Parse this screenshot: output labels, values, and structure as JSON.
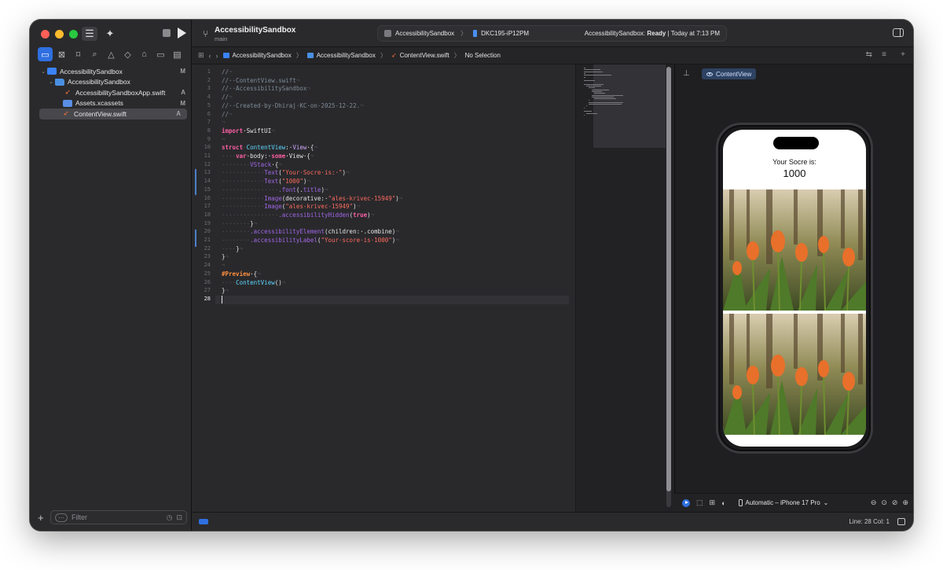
{
  "window": {
    "project_title": "AccessibilitySandbox",
    "branch": "main"
  },
  "activity": {
    "scheme": "AccessibilitySandbox",
    "separator": "〉",
    "device": "DKC195-iP12PM",
    "status_prefix": "AccessibilitySandbox: ",
    "status_state": "Ready",
    "status_suffix": " | Today at 7:13 PM"
  },
  "sidebar": {
    "nav_icons": [
      "folder-icon",
      "x-square-icon",
      "bookmark-icon",
      "search-icon",
      "warning-icon",
      "diamond-icon",
      "tag-icon",
      "breakpoint-icon",
      "report-icon"
    ],
    "tree": [
      {
        "label": "AccessibilitySandbox",
        "badge": "M",
        "kind": "proj",
        "indent": 0,
        "chev": "⌄"
      },
      {
        "label": "AccessibilitySandbox",
        "badge": "",
        "kind": "folder",
        "indent": 1,
        "chev": "⌄"
      },
      {
        "label": "AccessibilitySandboxApp.swift",
        "badge": "A",
        "kind": "swift",
        "indent": 2,
        "chev": ""
      },
      {
        "label": "Assets.xcassets",
        "badge": "M",
        "kind": "assets",
        "indent": 2,
        "chev": ""
      },
      {
        "label": "ContentView.swift",
        "badge": "A",
        "kind": "swift",
        "indent": 2,
        "chev": "",
        "selected": true
      }
    ],
    "filter_placeholder": "Filter"
  },
  "jumpbar": {
    "crumbs": [
      "AccessibilitySandbox",
      "AccessibilitySandbox",
      "ContentView.swift",
      "No Selection"
    ],
    "separator": "〉"
  },
  "editor": {
    "current_line": 28,
    "lines": [
      [
        {
          "t": "//",
          "c": "cm"
        },
        {
          "t": "¬",
          "c": "inv"
        }
      ],
      [
        {
          "t": "//·",
          "c": "cm"
        },
        {
          "t": "·ContentView.swift",
          "c": "cm"
        },
        {
          "t": "¬",
          "c": "inv"
        }
      ],
      [
        {
          "t": "//·",
          "c": "cm"
        },
        {
          "t": "·AccessibilitySandbox",
          "c": "cm"
        },
        {
          "t": "¬",
          "c": "inv"
        }
      ],
      [
        {
          "t": "//",
          "c": "cm"
        },
        {
          "t": "¬",
          "c": "inv"
        }
      ],
      [
        {
          "t": "//·",
          "c": "cm"
        },
        {
          "t": "·Created·by·Dhiraj·KC·on·2025-12-22.",
          "c": "cm"
        },
        {
          "t": "¬",
          "c": "inv"
        }
      ],
      [
        {
          "t": "//",
          "c": "cm"
        },
        {
          "t": "¬",
          "c": "inv"
        }
      ],
      [
        {
          "t": "¬",
          "c": "inv"
        }
      ],
      [
        {
          "t": "import",
          "c": "kw"
        },
        {
          "t": "·SwiftUI",
          "c": "pl"
        },
        {
          "t": "¬",
          "c": "inv"
        }
      ],
      [
        {
          "t": "¬",
          "c": "inv"
        }
      ],
      [
        {
          "t": "struct",
          "c": "kw"
        },
        {
          "t": "·",
          "c": "inv"
        },
        {
          "t": "ContentView",
          "c": "ty"
        },
        {
          "t": ":·",
          "c": "pl"
        },
        {
          "t": "View",
          "c": "ty2"
        },
        {
          "t": "·{",
          "c": "pl"
        },
        {
          "t": "¬",
          "c": "inv"
        }
      ],
      [
        {
          "t": "····",
          "c": "inv"
        },
        {
          "t": "var",
          "c": "kw"
        },
        {
          "t": "·body:·",
          "c": "pl"
        },
        {
          "t": "some",
          "c": "kw"
        },
        {
          "t": "·View·{",
          "c": "pl"
        },
        {
          "t": "¬",
          "c": "inv"
        }
      ],
      [
        {
          "t": "········",
          "c": "inv"
        },
        {
          "t": "VStack",
          "c": "fn"
        },
        {
          "t": "·{",
          "c": "pl"
        },
        {
          "t": "¬",
          "c": "inv"
        }
      ],
      [
        {
          "t": "············",
          "c": "inv"
        },
        {
          "t": "Text",
          "c": "fn"
        },
        {
          "t": "(",
          "c": "pl"
        },
        {
          "t": "\"Your·Socre·is:·\"",
          "c": "st"
        },
        {
          "t": ")",
          "c": "pl"
        },
        {
          "t": "¬",
          "c": "inv"
        }
      ],
      [
        {
          "t": "············",
          "c": "inv"
        },
        {
          "t": "Text",
          "c": "fn"
        },
        {
          "t": "(",
          "c": "pl"
        },
        {
          "t": "\"1000\"",
          "c": "st"
        },
        {
          "t": ")",
          "c": "pl"
        },
        {
          "t": "¬",
          "c": "inv"
        }
      ],
      [
        {
          "t": "················",
          "c": "inv"
        },
        {
          "t": ".font",
          "c": "fn2"
        },
        {
          "t": "(.",
          "c": "pl"
        },
        {
          "t": "title",
          "c": "fn2"
        },
        {
          "t": ")",
          "c": "pl"
        },
        {
          "t": "¬",
          "c": "inv"
        }
      ],
      [
        {
          "t": "············",
          "c": "inv"
        },
        {
          "t": "Image",
          "c": "fn"
        },
        {
          "t": "(decorative:·",
          "c": "pl"
        },
        {
          "t": "\"ales-krivec-15949\"",
          "c": "st"
        },
        {
          "t": ")",
          "c": "pl"
        },
        {
          "t": "¬",
          "c": "inv"
        }
      ],
      [
        {
          "t": "············",
          "c": "inv"
        },
        {
          "t": "Image",
          "c": "fn"
        },
        {
          "t": "(",
          "c": "pl"
        },
        {
          "t": "\"ales-krivec-15949\"",
          "c": "st"
        },
        {
          "t": ")",
          "c": "pl"
        },
        {
          "t": "¬",
          "c": "inv"
        }
      ],
      [
        {
          "t": "················",
          "c": "inv"
        },
        {
          "t": ".accessibilityHidden",
          "c": "fn2"
        },
        {
          "t": "(",
          "c": "pl"
        },
        {
          "t": "true",
          "c": "kw"
        },
        {
          "t": ")",
          "c": "pl"
        },
        {
          "t": "¬",
          "c": "inv"
        }
      ],
      [
        {
          "t": "········",
          "c": "inv"
        },
        {
          "t": "}",
          "c": "pl"
        },
        {
          "t": "¬",
          "c": "inv"
        }
      ],
      [
        {
          "t": "········",
          "c": "inv"
        },
        {
          "t": ".accessibilityElement",
          "c": "fn2"
        },
        {
          "t": "(children:·.combine)",
          "c": "pl"
        },
        {
          "t": "¬",
          "c": "inv"
        }
      ],
      [
        {
          "t": "········",
          "c": "inv"
        },
        {
          "t": ".accessibilityLabel",
          "c": "fn2"
        },
        {
          "t": "(",
          "c": "pl"
        },
        {
          "t": "\"Your·score·is·1000\"",
          "c": "st"
        },
        {
          "t": ")",
          "c": "pl"
        },
        {
          "t": "¬",
          "c": "inv"
        }
      ],
      [
        {
          "t": "····",
          "c": "inv"
        },
        {
          "t": "}",
          "c": "pl"
        },
        {
          "t": "¬",
          "c": "inv"
        }
      ],
      [
        {
          "t": "}",
          "c": "pl"
        },
        {
          "t": "¬",
          "c": "inv"
        }
      ],
      [
        {
          "t": "¬",
          "c": "inv"
        }
      ],
      [
        {
          "t": "#Preview",
          "c": "mac"
        },
        {
          "t": "·{",
          "c": "pl"
        },
        {
          "t": "¬",
          "c": "inv"
        }
      ],
      [
        {
          "t": "····",
          "c": "inv"
        },
        {
          "t": "ContentView",
          "c": "ty"
        },
        {
          "t": "()",
          "c": "pl"
        },
        {
          "t": "¬",
          "c": "inv"
        }
      ],
      [
        {
          "t": "}",
          "c": "pl"
        },
        {
          "t": "¬",
          "c": "inv"
        }
      ],
      []
    ]
  },
  "syntax_colors": {
    "cm": "#7f8c98",
    "inv": "#55555a",
    "kw": "#fc5fa3",
    "pl": "#e4e4e6",
    "ty": "#5dd8ff",
    "ty2": "#d0a8ff",
    "fn": "#a167e6",
    "fn2": "#a167e6",
    "st": "#fc6a5d",
    "mac": "#fd8f3f"
  },
  "preview": {
    "chip_label": "ContentView",
    "score_label": "Your Socre is:",
    "score_value": "1000",
    "device_label": "Automatic – iPhone 17 Pro",
    "device_chevron": "⌄"
  },
  "statusbar": {
    "position": "Line: 28  Col: 1"
  },
  "colors": {
    "accent": "#2f6fe0"
  }
}
